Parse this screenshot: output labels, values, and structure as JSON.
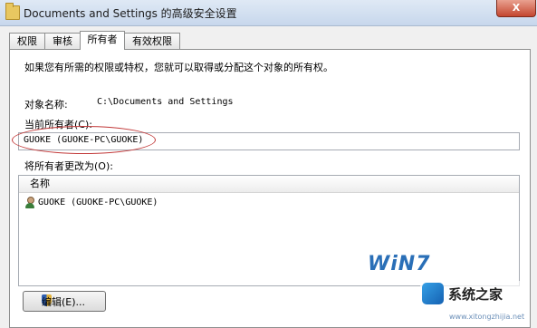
{
  "window": {
    "title": "Documents and Settings 的高级安全设置",
    "close_label": "X"
  },
  "tabs": [
    {
      "label": "权限"
    },
    {
      "label": "审核"
    },
    {
      "label": "所有者"
    },
    {
      "label": "有效权限"
    }
  ],
  "active_tab": "所有者",
  "owner_tab": {
    "description": "如果您有所需的权限或特权，您就可以取得或分配这个对象的所有权。",
    "object_name_label": "对象名称:",
    "object_name_value": "C:\\Documents and Settings",
    "current_owner_label": "当前所有者(C):",
    "current_owner_value": "GUOKE (GUOKE-PC\\GUOKE)",
    "change_owner_label": "将所有者更改为(O):",
    "list": {
      "column_header": "名称",
      "rows": [
        {
          "name": "GUOKE (GUOKE-PC\\GUOKE)",
          "icon": "user-icon"
        }
      ]
    },
    "edit_button_label": "编辑(E)..."
  },
  "watermark": {
    "logo_text": "WiN7",
    "site_name": "系统之家",
    "site_url": "www.xitongzhijia.net"
  },
  "colors": {
    "annotation_ellipse": "#c23a3a",
    "close_button": "#c4472f"
  }
}
